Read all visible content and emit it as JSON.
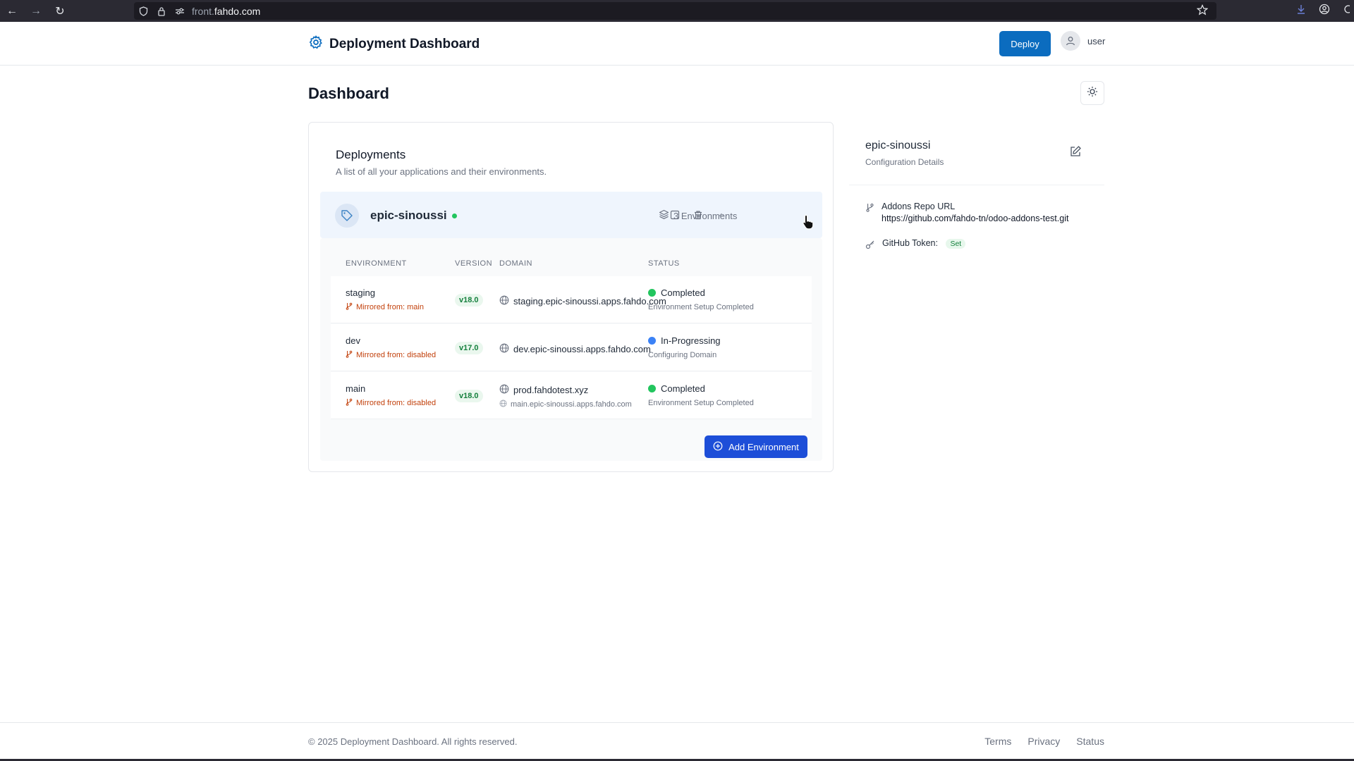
{
  "browser": {
    "url_prefix": "front.",
    "url_domain": "fahdo.com"
  },
  "header": {
    "title": "Deployment Dashboard",
    "deploy_label": "Deploy",
    "username": "user",
    "brand_icon": "gear-icon"
  },
  "page": {
    "title": "Dashboard"
  },
  "deployments": {
    "title": "Deployments",
    "subtitle": "A list of all your applications and their environments.",
    "app": {
      "name": "epic-sinoussi",
      "env_count": "3 Environments"
    },
    "columns": [
      "ENVIRONMENT",
      "VERSION",
      "DOMAIN",
      "STATUS"
    ],
    "environments": [
      {
        "name": "staging",
        "mirror": "Mirrored from: main",
        "version": "v18.0",
        "domain": "staging.epic-sinoussi.apps.fahdo.com",
        "subdomain": "",
        "status": "Completed",
        "status_color": "#22c55e",
        "status_detail": "Environment Setup Completed"
      },
      {
        "name": "dev",
        "mirror": "Mirrored from: disabled",
        "version": "v17.0",
        "domain": "dev.epic-sinoussi.apps.fahdo.com",
        "subdomain": "",
        "status": "In-Progressing",
        "status_color": "#3b82f6",
        "status_detail": "Configuring Domain"
      },
      {
        "name": "main",
        "mirror": "Mirrored from: disabled",
        "version": "v18.0",
        "domain": "prod.fahdotest.xyz",
        "subdomain": "main.epic-sinoussi.apps.fahdo.com",
        "status": "Completed",
        "status_color": "#22c55e",
        "status_detail": "Environment Setup Completed"
      }
    ],
    "add_env_label": "Add Environment"
  },
  "config": {
    "title": "epic-sinoussi",
    "subtitle": "Configuration Details",
    "repo_label": "Addons Repo URL",
    "repo_url": "https://github.com/fahdo-tn/odoo-addons-test.git",
    "token_label": "GitHub Token:",
    "token_status": "Set"
  },
  "footer": {
    "copyright": "© 2025 Deployment Dashboard. All rights reserved.",
    "links": [
      "Terms",
      "Privacy",
      "Status"
    ]
  },
  "colors": {
    "primary": "#0b6cbf",
    "accent_button": "#1d4ed8",
    "success": "#22c55e",
    "info": "#3b82f6",
    "mirror": "#c2410c"
  }
}
